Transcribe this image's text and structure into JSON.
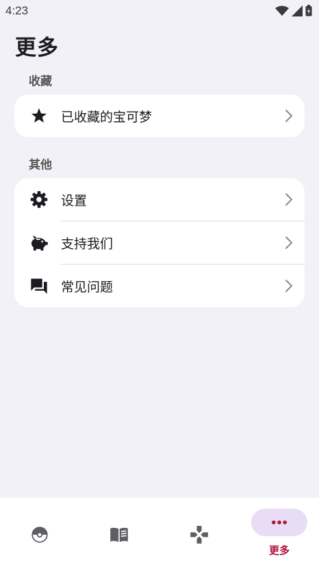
{
  "status_bar": {
    "time": "4:23"
  },
  "page_title": "更多",
  "sections": {
    "favorites": {
      "label": "收藏",
      "items": [
        {
          "label": "已收藏的宝可梦",
          "icon": "star-icon"
        }
      ]
    },
    "other": {
      "label": "其他",
      "items": [
        {
          "label": "设置",
          "icon": "gear-icon"
        },
        {
          "label": "支持我们",
          "icon": "piggy-bank-icon"
        },
        {
          "label": "常见问题",
          "icon": "forum-icon"
        }
      ]
    }
  },
  "bottom_nav": {
    "items": [
      {
        "icon": "pokeball-icon",
        "label": ""
      },
      {
        "icon": "book-icon",
        "label": ""
      },
      {
        "icon": "gamepad-icon",
        "label": ""
      },
      {
        "icon": "more-dots-icon",
        "label": "更多",
        "selected": true
      }
    ]
  },
  "colors": {
    "background": "#f2f1f7",
    "card": "#ffffff",
    "accent": "#b3123a",
    "selected_pill": "#e9dcf5",
    "icon_gray": "#5f5f63"
  }
}
